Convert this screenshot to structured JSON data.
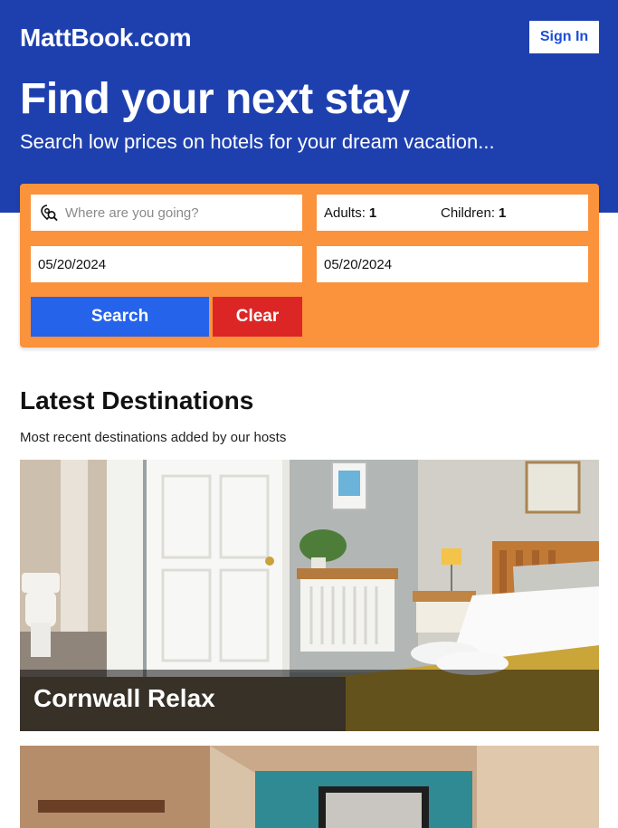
{
  "header": {
    "brand": "MattBook.com",
    "sign_in_label": "Sign In"
  },
  "hero": {
    "title": "Find your next stay",
    "subtitle": "Search low prices on hotels for your dream vacation..."
  },
  "search": {
    "destination_placeholder": "Where are you going?",
    "destination_icon": "map-search-icon",
    "adults_label": "Adults:",
    "adults_value": "1",
    "children_label": "Children:",
    "children_value": "1",
    "check_in": "05/20/2024",
    "check_out": "05/20/2024",
    "search_label": "Search",
    "clear_label": "Clear"
  },
  "destinations": {
    "title": "Latest Destinations",
    "subtitle": "Most recent destinations added by our hosts",
    "items": [
      {
        "name": "Cornwall Relax"
      },
      {
        "name": ""
      }
    ]
  },
  "colors": {
    "header_bg": "#1e40af",
    "search_panel_bg": "#fb923c",
    "search_button": "#2563eb",
    "clear_button": "#dc2626"
  }
}
